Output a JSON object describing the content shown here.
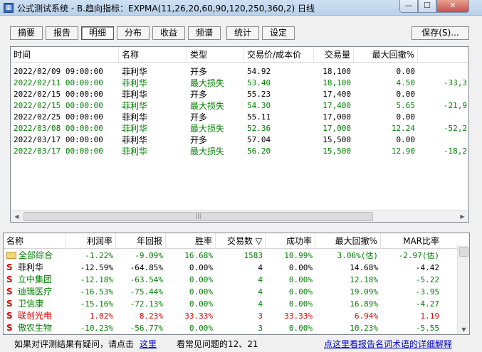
{
  "window": {
    "title": "公式测试系统 - B.趋向指标：EXPMA(11,26,20,60,90,120,250,360,2) 日线",
    "min": "—",
    "max": "☐",
    "close": "✕"
  },
  "tabs": [
    {
      "label": "摘要"
    },
    {
      "label": "报告"
    },
    {
      "label": "明细"
    },
    {
      "label": "分布"
    },
    {
      "label": "收益"
    },
    {
      "label": "频谱"
    },
    {
      "label": "统计"
    },
    {
      "label": "设定"
    }
  ],
  "active_tab": "明细",
  "save_label": "保存(S)...",
  "detail": {
    "headers": [
      "时间",
      "名称",
      "类型",
      "交易价/成本价",
      "交易量",
      "最大回撤%",
      ""
    ],
    "rows": [
      {
        "time": "2022/02/09 09:00:00",
        "name": "菲利华",
        "type": "开多",
        "price": "54.92",
        "vol": "18,100",
        "dd": "0.00",
        "extra": "",
        "color": "black"
      },
      {
        "time": "2022/02/11 00:00:00",
        "name": "菲利华",
        "type": "最大损失",
        "price": "53.40",
        "vol": "18,100",
        "dd": "4.50",
        "extra": "-33,3",
        "color": "green"
      },
      {
        "time": "2022/02/15 00:00:00",
        "name": "菲利华",
        "type": "开多",
        "price": "55.23",
        "vol": "17,400",
        "dd": "0.00",
        "extra": "",
        "color": "black"
      },
      {
        "time": "2022/02/15 00:00:00",
        "name": "菲利华",
        "type": "最大损失",
        "price": "54.30",
        "vol": "17,400",
        "dd": "5.65",
        "extra": "-21,9",
        "color": "green"
      },
      {
        "time": "2022/02/25 00:00:00",
        "name": "菲利华",
        "type": "开多",
        "price": "55.11",
        "vol": "17,000",
        "dd": "0.00",
        "extra": "",
        "color": "black"
      },
      {
        "time": "2022/03/08 00:00:00",
        "name": "菲利华",
        "type": "最大损失",
        "price": "52.36",
        "vol": "17,000",
        "dd": "12.24",
        "extra": "-52,2",
        "color": "green"
      },
      {
        "time": "2022/03/17 00:00:00",
        "name": "菲利华",
        "type": "开多",
        "price": "57.04",
        "vol": "15,500",
        "dd": "0.00",
        "extra": "",
        "color": "black"
      },
      {
        "time": "2022/03/17 00:00:00",
        "name": "菲利华",
        "type": "最大损失",
        "price": "56.20",
        "vol": "15,500",
        "dd": "12.90",
        "extra": "-18,2",
        "color": "green"
      }
    ]
  },
  "summary": {
    "headers": [
      "名称",
      "利润率",
      "年回报",
      "胜率",
      "交易数 ▽",
      "成功率",
      "最大回撤%",
      "MAR比率"
    ],
    "rows": [
      {
        "name": "全部综合",
        "icon": "folder",
        "profit": "-1.22%",
        "annual": "-9.09%",
        "win": "16.68%",
        "trades": "1583",
        "success": "10.99%",
        "dd": "3.06%(估)",
        "mar": "-2.97(估)",
        "color": "green",
        "name_color": "green"
      },
      {
        "name": "菲利华",
        "icon": "S",
        "profit": "-12.59%",
        "annual": "-64.85%",
        "win": "0.00%",
        "trades": "4",
        "success": "0.00%",
        "dd": "14.68%",
        "mar": "-4.42",
        "color": "black",
        "name_color": "black"
      },
      {
        "name": "立中集团",
        "icon": "S",
        "profit": "-12.18%",
        "annual": "-63.54%",
        "win": "0.00%",
        "trades": "4",
        "success": "0.00%",
        "dd": "12.18%",
        "mar": "-5.22",
        "color": "green",
        "name_color": "green"
      },
      {
        "name": "迪瑞医疗",
        "icon": "S",
        "profit": "-16.53%",
        "annual": "-75.44%",
        "win": "0.00%",
        "trades": "4",
        "success": "0.00%",
        "dd": "19.09%",
        "mar": "-3.95",
        "color": "green",
        "name_color": "green"
      },
      {
        "name": "卫信康",
        "icon": "S",
        "profit": "-15.16%",
        "annual": "-72.13%",
        "win": "0.00%",
        "trades": "4",
        "success": "0.00%",
        "dd": "16.89%",
        "mar": "-4.27",
        "color": "green",
        "name_color": "green"
      },
      {
        "name": "联创光电",
        "icon": "S",
        "profit": "1.02%",
        "annual": "8.23%",
        "win": "33.33%",
        "trades": "3",
        "success": "33.33%",
        "dd": "6.94%",
        "mar": "1.19",
        "color": "red",
        "name_color": "red"
      },
      {
        "name": "傲农生物",
        "icon": "S",
        "profit": "-10.23%",
        "annual": "-56.77%",
        "win": "0.00%",
        "trades": "3",
        "success": "0.00%",
        "dd": "10.23%",
        "mar": "-5.55",
        "color": "green",
        "name_color": "green"
      }
    ]
  },
  "footer": {
    "question_text": "如果对评测结果有疑问，请点击",
    "here_link": "这里",
    "faq_text": "看常见问题的12、21",
    "detail_link": "点这里看报告名词术语的详细解释"
  },
  "colors": {
    "green": "#008000",
    "red": "#e00000",
    "link": "#0000cc"
  }
}
